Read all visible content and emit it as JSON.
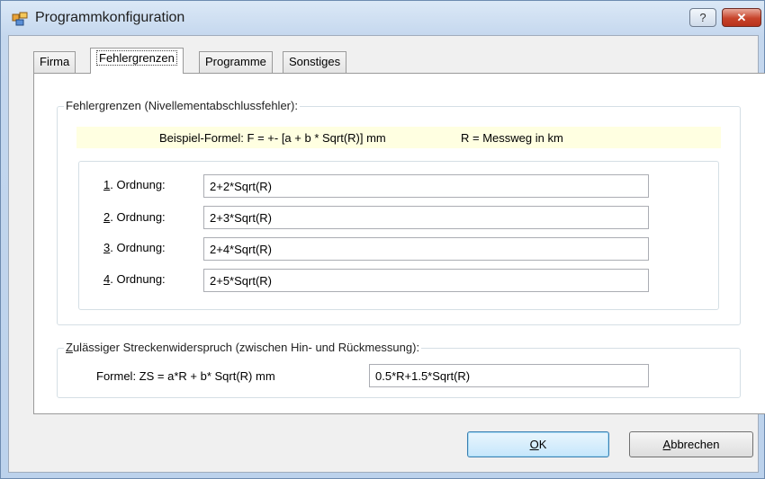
{
  "window": {
    "title": "Programmkonfiguration",
    "help_label": "?",
    "close_label": "✕"
  },
  "tabs": [
    {
      "label": "Firma"
    },
    {
      "label": "Fehlergrenzen",
      "active": true
    },
    {
      "label": "Programme"
    },
    {
      "label": "Sonstiges"
    }
  ],
  "error_limits": {
    "group_title": "Fehlergrenzen (Nivellementabschlussfehler):",
    "example_formula": "Beispiel-Formel:  F = +- [a + b * Sqrt(R)] mm",
    "example_note": "R = Messweg in km",
    "orders": [
      {
        "mnemonic": "1",
        "label_rest": ". Ordnung:",
        "value": "2+2*Sqrt(R)"
      },
      {
        "mnemonic": "2",
        "label_rest": ". Ordnung:",
        "value": "2+3*Sqrt(R)"
      },
      {
        "mnemonic": "3",
        "label_rest": ". Ordnung:",
        "value": "2+4*Sqrt(R)"
      },
      {
        "mnemonic": "4",
        "label_rest": ". Ordnung:",
        "value": "2+5*Sqrt(R)"
      }
    ]
  },
  "distance": {
    "group_title_mnemonic": "Z",
    "group_title_rest": "ulässiger Streckenwiderspruch (zwischen Hin- und Rückmessung):",
    "formula_label": "Formel: ZS = a*R + b* Sqrt(R) mm",
    "formula_value": "0.5*R+1.5*Sqrt(R)"
  },
  "buttons": {
    "ok_mnemonic": "O",
    "ok_rest": "K",
    "cancel_mnemonic": "A",
    "cancel_rest": "bbrechen"
  },
  "colors": {
    "hint_background": "#ffffe1",
    "close_button": "#c7432a"
  }
}
